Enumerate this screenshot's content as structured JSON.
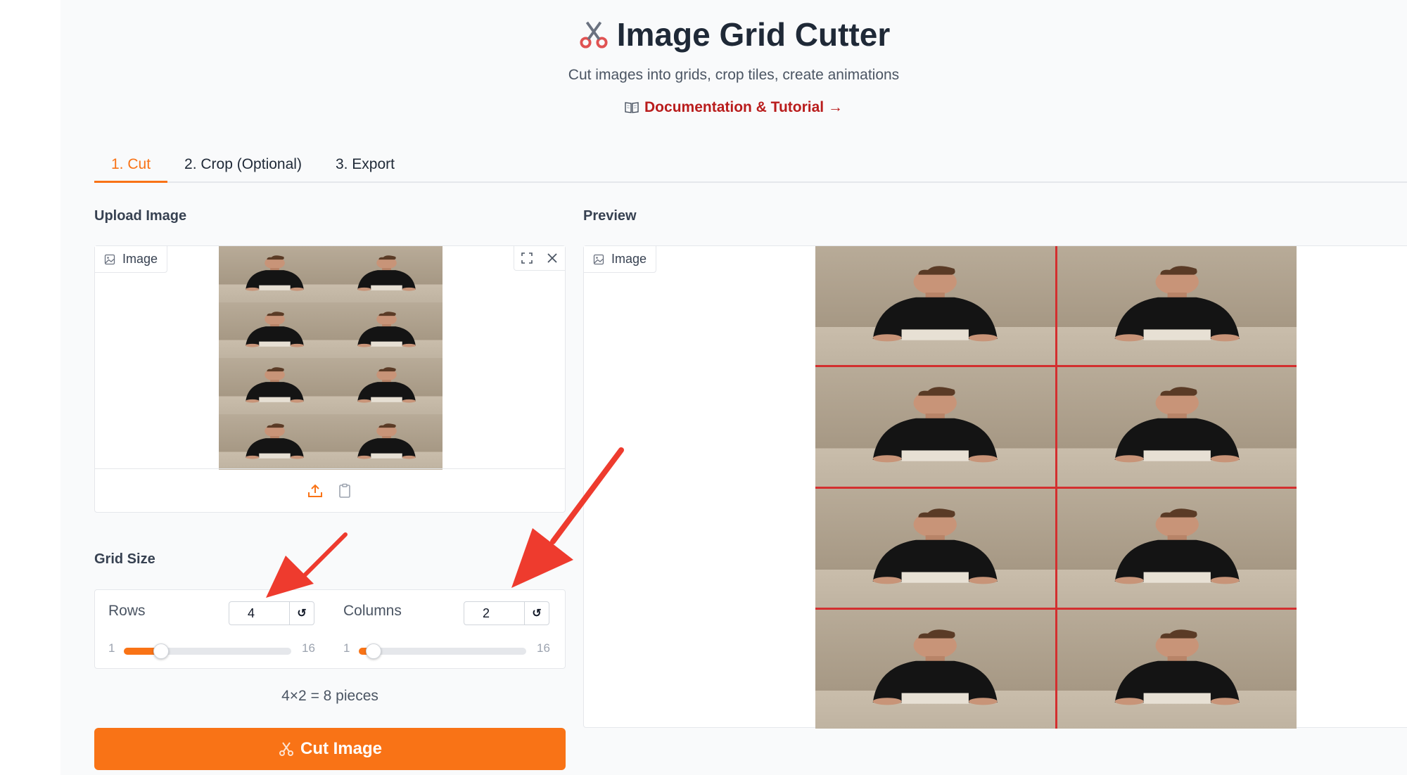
{
  "app": {
    "title": "Image Grid Cutter",
    "subtitle": "Cut images into grids, crop tiles, create animations",
    "doc_link": "Documentation & Tutorial →",
    "accent_color": "#f97316",
    "link_color": "#b91c1c"
  },
  "tabs": [
    {
      "label": "1. Cut",
      "active": true
    },
    {
      "label": "2. Crop (Optional)",
      "active": false
    },
    {
      "label": "3. Export",
      "active": false
    }
  ],
  "upload": {
    "section_label": "Upload Image",
    "badge_label": "Image",
    "icons": [
      "fullscreen-icon",
      "close-icon",
      "upload-icon",
      "clipboard-icon"
    ]
  },
  "preview": {
    "section_label": "Preview",
    "badge_label": "Image",
    "grid_line_color": "#d32f2f"
  },
  "grid_size": {
    "section_label": "Grid Size",
    "rows": {
      "label": "Rows",
      "value": "4",
      "min": "1",
      "max": "16",
      "reset": "↺"
    },
    "columns": {
      "label": "Columns",
      "value": "2",
      "min": "1",
      "max": "16",
      "reset": "↺"
    },
    "summary": "4×2 = 8 pieces"
  },
  "cut_button": {
    "label": "Cut Image"
  }
}
